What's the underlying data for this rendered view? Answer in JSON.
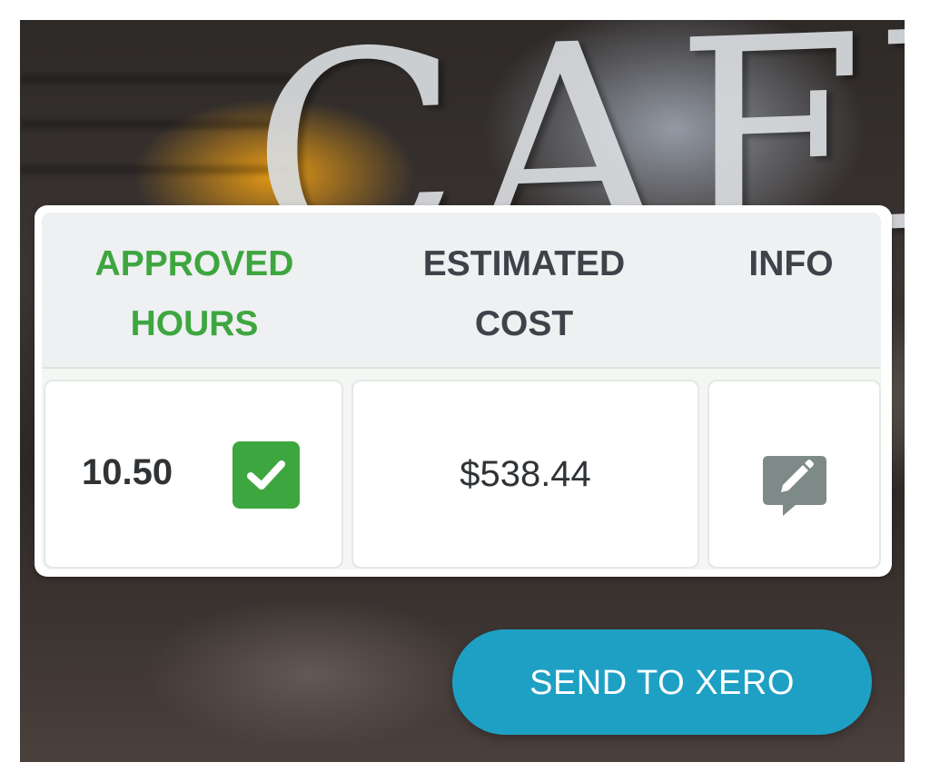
{
  "columns": {
    "approved_hours": [
      "APPROVED",
      "HOURS"
    ],
    "estimated_cost": [
      "ESTIMATED",
      "COST"
    ],
    "info": "INFO"
  },
  "row": {
    "approved_hours": "10.50",
    "approved": true,
    "estimated_cost": "$538.44"
  },
  "icons": {
    "approved": "check-icon",
    "info": "edit-comment-icon"
  },
  "actions": {
    "send_label": "SEND TO XERO"
  },
  "background_letters": "CAFE",
  "colors": {
    "approved_green": "#3ea63f",
    "header_text": "#3d4349",
    "send_button": "#1ea0c4",
    "icon_gray": "#7e8a87"
  }
}
